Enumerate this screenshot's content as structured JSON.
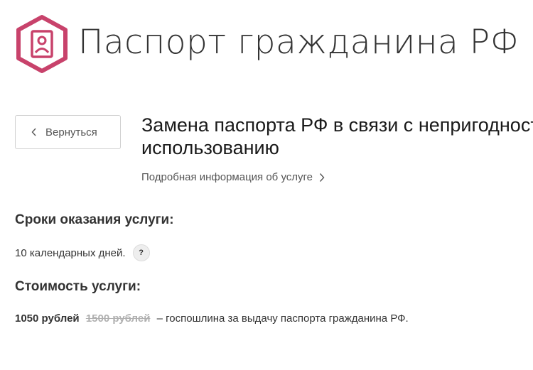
{
  "colors": {
    "brand": "#c8426b",
    "text": "#333333",
    "muted": "#555555",
    "strikethrough": "#b0b0b0"
  },
  "header": {
    "logo_icon": "passport-icon",
    "title": "Паспорт гражданина РФ"
  },
  "navigation": {
    "back_label": "Вернуться",
    "back_icon": "chevron-left-icon"
  },
  "service": {
    "title_line1": "Замена паспорта РФ в связи с непригодностью к",
    "title_line2": "использованию",
    "info_link": "Подробная информация об услуге",
    "info_icon": "chevron-right-icon"
  },
  "terms": {
    "heading": "Сроки оказания услуги:",
    "text": "10 календарных дней.",
    "help_icon": "question-icon",
    "help_symbol": "?"
  },
  "cost": {
    "heading": "Стоимость услуги:",
    "new_price": "1050 рублей",
    "old_price": "1500 рублей",
    "description": "– госпошлина за выдачу паспорта гражданина РФ."
  }
}
